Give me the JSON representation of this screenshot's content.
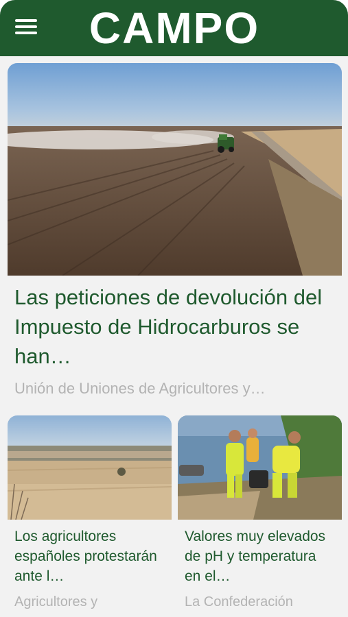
{
  "header": {
    "logo": "CAMPO",
    "menu_icon": "hamburger-menu-icon",
    "background": "#1f5a2e"
  },
  "featured": {
    "image_alt": "Tractor working a plowed field",
    "title": "Las peticiones de devolución del Impuesto de Hidrocarburos se han…",
    "source": "Unión de Uniones de Agricultores y…"
  },
  "cards": [
    {
      "image_alt": "Dry field with town in the distance",
      "title": "Los agricultores españoles protestarán ante l…",
      "source": "Agricultores y"
    },
    {
      "image_alt": "Workers sampling water by a river",
      "title": "Valores muy elevados de pH y temperatura en el…",
      "source": "La Confederación"
    }
  ],
  "colors": {
    "accent": "#1f5a2e",
    "muted_text": "#b3b3b3",
    "feed_background": "#f2f2f2"
  }
}
